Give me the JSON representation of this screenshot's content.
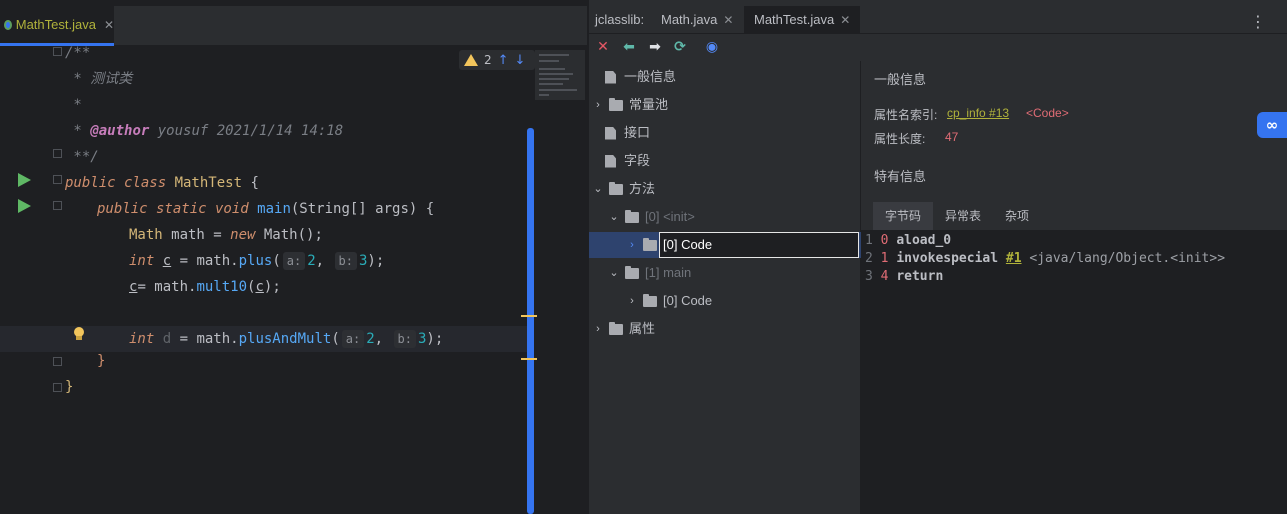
{
  "editor": {
    "tab": {
      "label": "MathTest.java",
      "close": "✕"
    },
    "inspection": {
      "count": "2",
      "up": "↑",
      "down": "↓"
    },
    "code": {
      "l1": "/**",
      "l2": " * 测试类",
      "l3": " *",
      "l4_tag": "@author",
      "l4_rest": " yousuf 2021/1/14 14:18",
      "l5": " **/",
      "l6_kw": "public class ",
      "l6_cls": "MathTest",
      "l6_end": " {",
      "l7_kw": "public static void ",
      "l7_fn": "main",
      "l7_args": "(String[] args) {",
      "l8_cls": "Math",
      "l8_a": " math = ",
      "l8_kw": "new ",
      "l8_b": "Math();",
      "l9_kw": "int ",
      "l9_var": "c",
      "l9_a": " = math.",
      "l9_fn": "plus",
      "l9_p": "(",
      "l9_h1": "a:",
      "l9_v1": "2",
      "l9_c": ",",
      "l9_h2": "b:",
      "l9_v2": "3",
      "l9_end": ");",
      "l10_var": "c",
      "l10_a": "= math.",
      "l10_fn": "mult10",
      "l10_p": "(",
      "l10_arg": "c",
      "l10_end": ");",
      "l12_kw": "int ",
      "l12_var": "d",
      "l12_a": " = math.",
      "l12_fn": "plusAndMult",
      "l12_p": "(",
      "l12_h1": "a:",
      "l12_v1": "2",
      "l12_c": ",",
      "l12_h2": "b:",
      "l12_v2": "3",
      "l12_end": ");",
      "l13": "}",
      "l14": "}"
    }
  },
  "jclasslib": {
    "tabs": {
      "prefix": "jclasslib:",
      "t1": "Math.java",
      "t2": "MathTest.java",
      "close": "✕",
      "more": "⋮"
    },
    "toolbar": {
      "close": "✕",
      "back": "⬅",
      "forward": "➡",
      "refresh": "⟳",
      "web": "◉"
    },
    "tree": {
      "general": "一般信息",
      "constant_pool": "常量池",
      "interfaces": "接口",
      "fields": "字段",
      "methods": "方法",
      "m0": "[0] <init>",
      "m0_code": "[0] Code",
      "m1": "[1] main",
      "m1_code": "[0] Code",
      "attributes": "属性"
    },
    "detail": {
      "general_title": "一般信息",
      "name_index_label": "属性名索引:",
      "name_index_link": "cp_info #13",
      "name_index_value": "<Code>",
      "length_label": "属性长度:",
      "length_value": "47",
      "specific_title": "特有信息",
      "subtabs": [
        "字节码",
        "异常表",
        "杂项"
      ],
      "bytecode": [
        {
          "line": "1",
          "offset": "0",
          "op": "aload_0",
          "ref": "",
          "comment": ""
        },
        {
          "line": "2",
          "offset": "1",
          "op": "invokespecial",
          "ref": "#1",
          "comment": "<java/lang/Object.<init>>"
        },
        {
          "line": "3",
          "offset": "4",
          "op": "return",
          "ref": "",
          "comment": ""
        }
      ]
    }
  },
  "colors": {
    "accent": "#3574f0",
    "run": "#5fb865",
    "warn": "#f2c55c"
  }
}
